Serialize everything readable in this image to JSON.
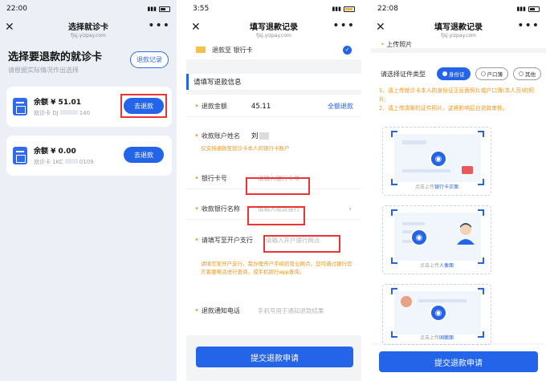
{
  "screens": {
    "select_card": {
      "status": {
        "time": "22:00"
      },
      "nav": {
        "title": "选择就诊卡",
        "url": "fjsj.yizpay.com"
      },
      "heading": "选择要退款的就诊卡",
      "subheading": "请根据实际情况作出选择",
      "records_button": "退款记录",
      "cards": [
        {
          "balance_label": "余额",
          "balance": "¥ 51.01",
          "card_prefix": "就诊卡 DJ",
          "card_suffix": "140",
          "action": "去退款"
        },
        {
          "balance_label": "余额",
          "balance": "¥ 0.00",
          "card_prefix": "就诊卡 1KC",
          "card_suffix": "0109",
          "action": "去退款"
        }
      ]
    },
    "refund_form": {
      "status": {
        "time": "3:55"
      },
      "nav": {
        "title": "填写退款记录",
        "url": "fjsj.yizpay.com"
      },
      "refund_to": "退款至 银行卡",
      "section_title": "请填写退款信息",
      "fields": {
        "amount": {
          "label": "退款金额",
          "value": "45.11",
          "action": "全额退款"
        },
        "account_name": {
          "label": "收款账户姓名",
          "value": "刘"
        },
        "name_note": "仅支持退款至就诊卡本人的银行卡账户",
        "card_no": {
          "label": "银行卡号",
          "placeholder": "请输入银行卡号"
        },
        "bank": {
          "label": "收款银行名称",
          "placeholder": "请输入收款银行"
        },
        "branch": {
          "label": "请填写至开户支行",
          "placeholder": "请输入开户银行网点"
        },
        "branch_note": "请填写至开户支行，需办理开户手续的营业网点。您可通过银行官方客服电话进行查询，或手机银行app查询。",
        "phone": {
          "label": "退款通知电话",
          "placeholder": "手机号用于通知退款结果"
        }
      },
      "submit": "提交退款申请"
    },
    "upload_id": {
      "status": {
        "time": "22:08"
      },
      "nav": {
        "title": "填写退款记录",
        "url": "fjsj.yizpay.com"
      },
      "cut_heading": "上传照片",
      "doc_type_label": "请选择证件类型",
      "doc_types": [
        "身份证",
        "户口簿",
        "其他"
      ],
      "tips": [
        "1、请上传就诊卡本人的身份证正反面照片或户口簿(本人页)的照片;",
        "2、请上传清晰的证件照片，这将影响后台退款审核。"
      ],
      "uploads": [
        {
          "prefix": "点击上传",
          "target": "银行卡正面"
        },
        {
          "prefix": "点击上传",
          "target": "人像面"
        },
        {
          "prefix": "点击上传",
          "target": "国徽面"
        }
      ],
      "submit": "提交退款申请"
    }
  },
  "colors": {
    "accent": "#2464e8",
    "warning": "#f0961a",
    "highlight": "#e33333"
  }
}
